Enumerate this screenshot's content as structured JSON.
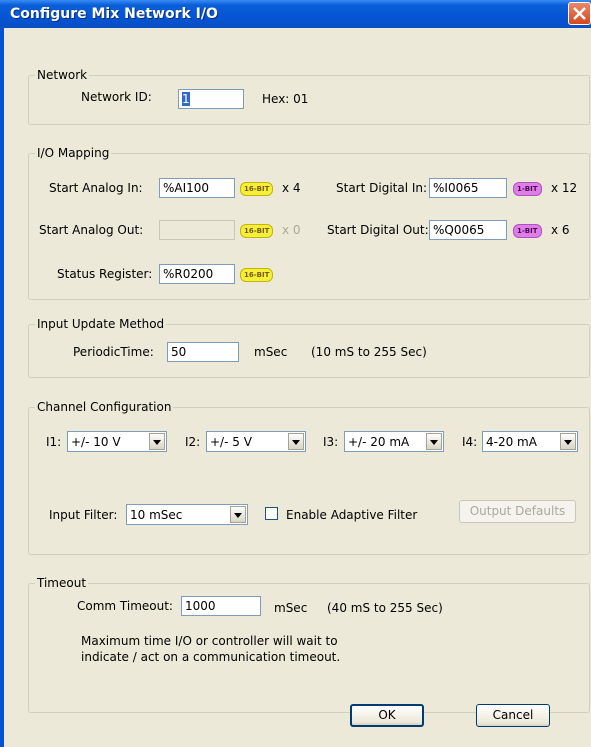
{
  "window": {
    "title": "Configure Mix Network I/O",
    "close_label": "X"
  },
  "network": {
    "legend": "Network",
    "id_label": "Network ID:",
    "id_value": "1",
    "hex_text": "Hex: 01"
  },
  "io_mapping": {
    "legend": "I/O Mapping",
    "analog_in": {
      "label": "Start Analog In:",
      "value": "%AI100",
      "badge": "16-BIT",
      "count": "x 4"
    },
    "analog_out": {
      "label": "Start Analog Out:",
      "value": "",
      "badge": "16-BIT",
      "count": "x 0"
    },
    "status_reg": {
      "label": "Status Register:",
      "value": "%R0200",
      "badge": "16-BIT"
    },
    "digital_in": {
      "label": "Start Digital In:",
      "value": "%I0065",
      "badge": "1-BIT",
      "count": "x 12"
    },
    "digital_out": {
      "label": "Start Digital Out:",
      "value": "%Q0065",
      "badge": "1-BIT",
      "count": "x 6"
    }
  },
  "input_update": {
    "legend": "Input Update Method",
    "periodic_label": "PeriodicTime:",
    "periodic_value": "50",
    "unit": "mSec",
    "range": "(10 mS to 255 Sec)"
  },
  "channel_config": {
    "legend": "Channel Configuration",
    "channels": [
      {
        "label": "I1:",
        "value": "+/- 10 V"
      },
      {
        "label": "I2:",
        "value": "+/- 5 V"
      },
      {
        "label": "I3:",
        "value": "+/- 20 mA"
      },
      {
        "label": "I4:",
        "value": "4-20 mA"
      }
    ],
    "input_filter_label": "Input Filter:",
    "input_filter_value": "10 mSec",
    "adaptive_label": "Enable Adaptive Filter",
    "adaptive_checked": false,
    "output_defaults_label": "Output Defaults"
  },
  "timeout": {
    "legend": "Timeout",
    "comm_label": "Comm Timeout:",
    "comm_value": "1000",
    "unit": "mSec",
    "range": "(40 mS to 255 Sec)",
    "desc_line1": "Maximum time I/O or controller will wait to",
    "desc_line2": "indicate / act on a communication timeout."
  },
  "buttons": {
    "ok": "OK",
    "cancel": "Cancel"
  }
}
